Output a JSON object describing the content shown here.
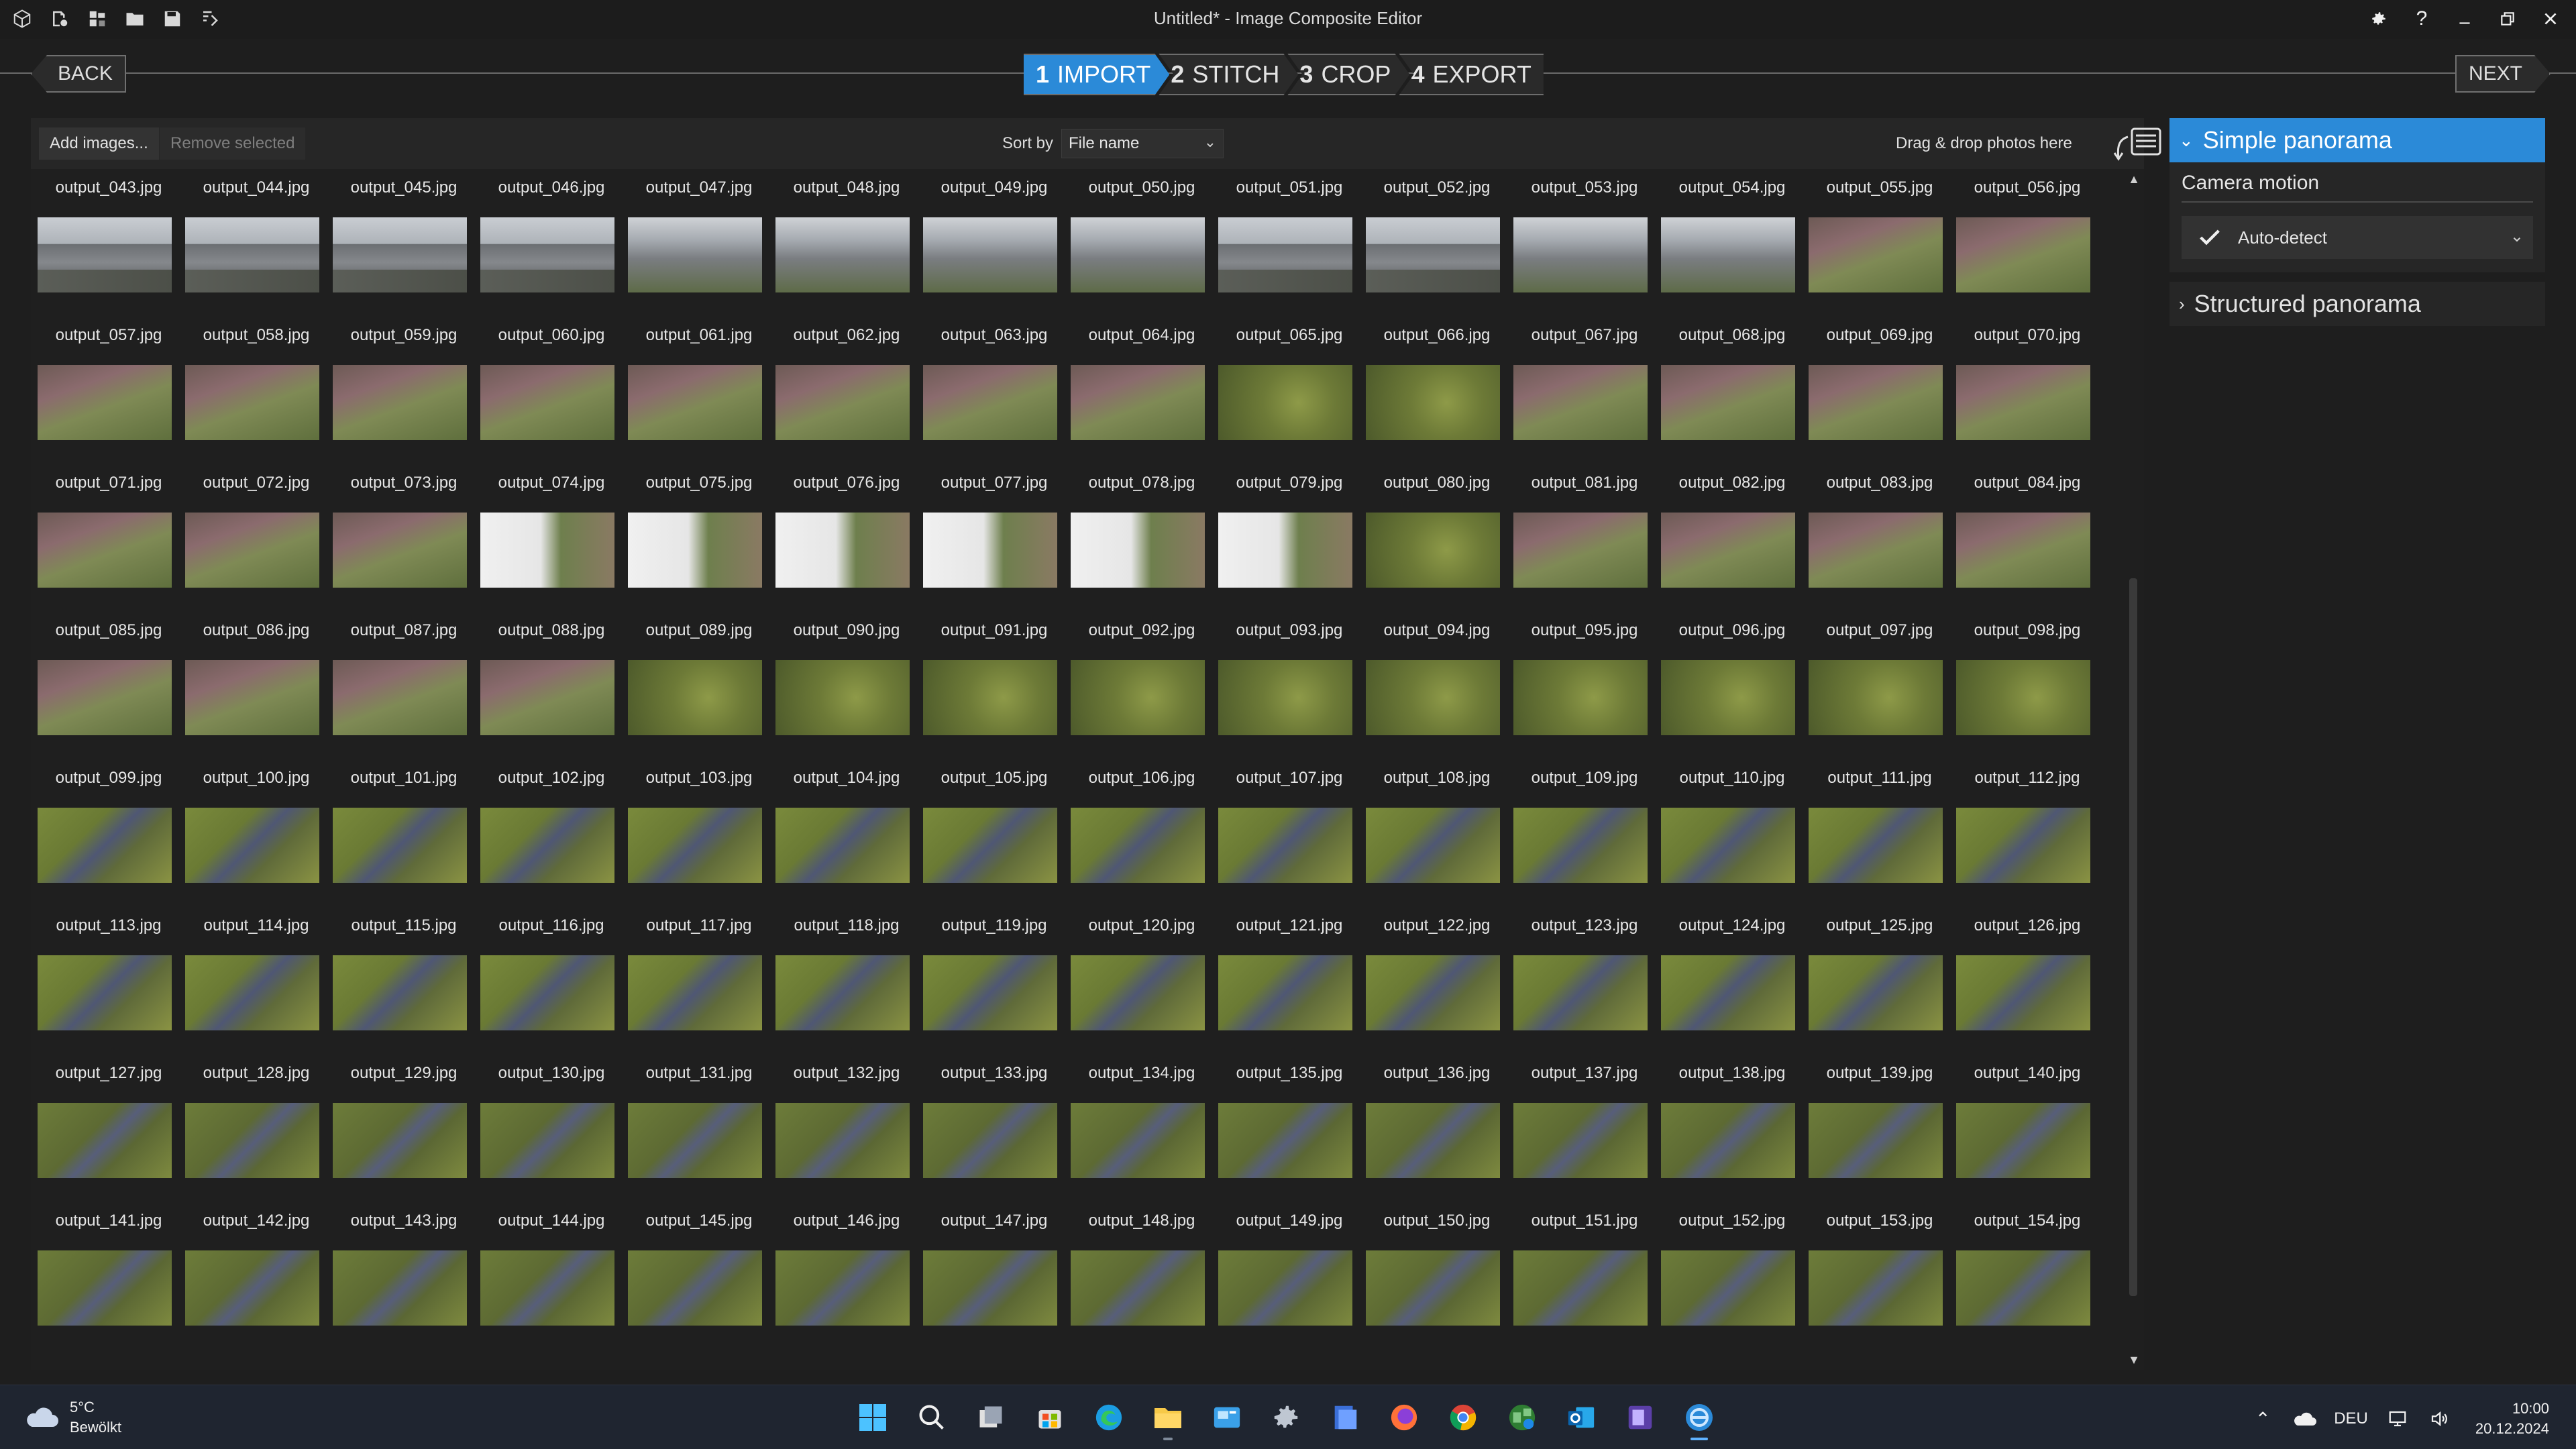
{
  "window": {
    "title": "Untitled* - Image Composite Editor"
  },
  "wizard": {
    "back_label": "BACK",
    "next_label": "NEXT",
    "steps": [
      {
        "num": "1",
        "label": "IMPORT",
        "active": true
      },
      {
        "num": "2",
        "label": "STITCH",
        "active": false
      },
      {
        "num": "3",
        "label": "CROP",
        "active": false
      },
      {
        "num": "4",
        "label": "EXPORT",
        "active": false
      }
    ]
  },
  "toolbar": {
    "add_images": "Add images...",
    "remove_selected": "Remove selected",
    "sort_label": "Sort by",
    "sort_value": "File name",
    "drop_hint": "Drag & drop photos here"
  },
  "grid": {
    "columns": 14,
    "rows": [
      {
        "labels": [
          "output_043.jpg",
          "output_044.jpg",
          "output_045.jpg",
          "output_046.jpg",
          "output_047.jpg",
          "output_048.jpg",
          "output_049.jpg",
          "output_050.jpg",
          "output_051.jpg",
          "output_052.jpg",
          "output_053.jpg",
          "output_054.jpg",
          "output_055.jpg",
          "output_056.jpg"
        ],
        "thumbs": [
          "building",
          "building",
          "building",
          "building",
          "trees",
          "trees",
          "trees",
          "trees",
          "building",
          "building",
          "trees",
          "trees",
          "yard",
          "yard"
        ]
      },
      {
        "labels": [
          "output_057.jpg",
          "output_058.jpg",
          "output_059.jpg",
          "output_060.jpg",
          "output_061.jpg",
          "output_062.jpg",
          "output_063.jpg",
          "output_064.jpg",
          "output_065.jpg",
          "output_066.jpg",
          "output_067.jpg",
          "output_068.jpg",
          "output_069.jpg",
          "output_070.jpg"
        ],
        "thumbs": [
          "yard",
          "yard",
          "yard",
          "yard",
          "yard",
          "yard",
          "yard",
          "yard",
          "grass",
          "grass",
          "yard",
          "yard",
          "yard",
          "yard"
        ]
      },
      {
        "labels": [
          "output_071.jpg",
          "output_072.jpg",
          "output_073.jpg",
          "output_074.jpg",
          "output_075.jpg",
          "output_076.jpg",
          "output_077.jpg",
          "output_078.jpg",
          "output_079.jpg",
          "output_080.jpg",
          "output_081.jpg",
          "output_082.jpg",
          "output_083.jpg",
          "output_084.jpg"
        ],
        "thumbs": [
          "yard",
          "yard",
          "yard",
          "wall",
          "wall",
          "wall",
          "wall",
          "wall",
          "wall",
          "grass",
          "yard",
          "yard",
          "yard",
          "yard"
        ]
      },
      {
        "labels": [
          "output_085.jpg",
          "output_086.jpg",
          "output_087.jpg",
          "output_088.jpg",
          "output_089.jpg",
          "output_090.jpg",
          "output_091.jpg",
          "output_092.jpg",
          "output_093.jpg",
          "output_094.jpg",
          "output_095.jpg",
          "output_096.jpg",
          "output_097.jpg",
          "output_098.jpg"
        ],
        "thumbs": [
          "yard",
          "yard",
          "yard",
          "yard",
          "grass",
          "grass",
          "grass",
          "grass",
          "grass",
          "grass",
          "grass",
          "grass",
          "grass",
          "grass"
        ]
      },
      {
        "labels": [
          "output_099.jpg",
          "output_100.jpg",
          "output_101.jpg",
          "output_102.jpg",
          "output_103.jpg",
          "output_104.jpg",
          "output_105.jpg",
          "output_106.jpg",
          "output_107.jpg",
          "output_108.jpg",
          "output_109.jpg",
          "output_110.jpg",
          "output_111.jpg",
          "output_112.jpg"
        ],
        "thumbs": [
          "path",
          "path",
          "path",
          "path",
          "path",
          "path",
          "path",
          "path",
          "path",
          "path",
          "path",
          "path",
          "path",
          "path"
        ]
      },
      {
        "labels": [
          "output_113.jpg",
          "output_114.jpg",
          "output_115.jpg",
          "output_116.jpg",
          "output_117.jpg",
          "output_118.jpg",
          "output_119.jpg",
          "output_120.jpg",
          "output_121.jpg",
          "output_122.jpg",
          "output_123.jpg",
          "output_124.jpg",
          "output_125.jpg",
          "output_126.jpg"
        ],
        "thumbs": [
          "path",
          "path",
          "path",
          "path",
          "path",
          "path",
          "path",
          "path",
          "path",
          "path",
          "path",
          "path",
          "path",
          "path"
        ]
      },
      {
        "labels": [
          "output_127.jpg",
          "output_128.jpg",
          "output_129.jpg",
          "output_130.jpg",
          "output_131.jpg",
          "output_132.jpg",
          "output_133.jpg",
          "output_134.jpg",
          "output_135.jpg",
          "output_136.jpg",
          "output_137.jpg",
          "output_138.jpg",
          "output_139.jpg",
          "output_140.jpg"
        ],
        "thumbs": [
          "dark",
          "dark",
          "dark",
          "dark",
          "dark",
          "dark",
          "dark",
          "dark",
          "dark",
          "dark",
          "dark",
          "dark",
          "dark",
          "dark"
        ]
      },
      {
        "labels": [
          "output_141.jpg",
          "output_142.jpg",
          "output_143.jpg",
          "output_144.jpg",
          "output_145.jpg",
          "output_146.jpg",
          "output_147.jpg",
          "output_148.jpg",
          "output_149.jpg",
          "output_150.jpg",
          "output_151.jpg",
          "output_152.jpg",
          "output_153.jpg",
          "output_154.jpg"
        ],
        "thumbs": [
          "dark",
          "dark",
          "dark",
          "dark",
          "dark",
          "dark",
          "dark",
          "dark",
          "dark",
          "dark",
          "dark",
          "dark",
          "dark",
          "dark"
        ]
      }
    ]
  },
  "right_panel": {
    "simple_title": "Simple panorama",
    "camera_motion_label": "Camera motion",
    "camera_motion_value": "Auto-detect",
    "structured_title": "Structured panorama"
  },
  "taskbar": {
    "weather_temp": "5°C",
    "weather_desc": "Bewölkt",
    "language": "DEU",
    "time": "10:00",
    "date": "20.12.2024"
  },
  "colors": {
    "accent": "#2b8ad8",
    "background": "#1e1e1e"
  }
}
